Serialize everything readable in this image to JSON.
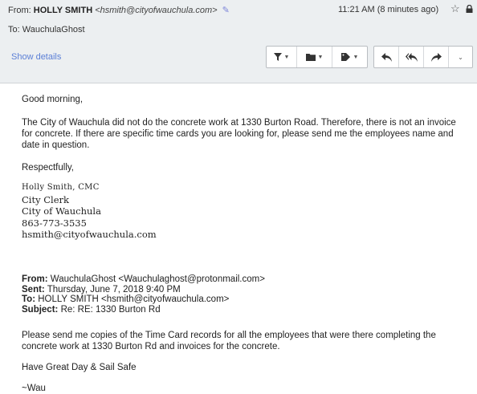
{
  "header": {
    "from_prefix": "From:",
    "from_name": "HOLLY SMITH",
    "from_email": "<hsmith@cityofwauchula.com>",
    "time": "11:21 AM (8 minutes ago)",
    "to_prefix": "To:",
    "to_name": "WauchulaGhost",
    "show_details": "Show details",
    "icons": [
      "pencil-icon",
      "star-icon",
      "lock-icon",
      "filter-icon",
      "folder-icon",
      "tag-icon",
      "reply-icon",
      "reply-all-icon",
      "forward-icon",
      "more-icon"
    ]
  },
  "message": {
    "greeting": "Good morning,",
    "para1": "The City of Wauchula did not do the concrete work at 1330 Burton Road. Therefore, there is not an invoice for concrete. If there are specific time cards you are looking for, please send me the employees name and date in question.",
    "closing": "Respectfully,",
    "signature": {
      "name": "Holly Smith, CMC",
      "title": "City Clerk",
      "org": "City of Wauchula",
      "phone": "863-773-3535",
      "email": "hsmith@cityofwauchula.com"
    }
  },
  "quoted": {
    "from_label": "From:",
    "from_value": "WauchulaGhost <Wauchulaghost@protonmail.com>",
    "sent_label": "Sent:",
    "sent_value": "Thursday, June 7, 2018 9:40 PM",
    "to_label": "To:",
    "to_value": "HOLLY SMITH <hsmith@cityofwauchula.com>",
    "subject_label": "Subject:",
    "subject_value": "Re: RE: 1330 Burton Rd",
    "body": "Please send me copies of the Time Card records for all the employees that were there completing the concrete work at 1330 Burton Rd and invoices for the concrete.",
    "farewell": "Have Great Day & Sail Safe",
    "sign": "~Wau"
  }
}
